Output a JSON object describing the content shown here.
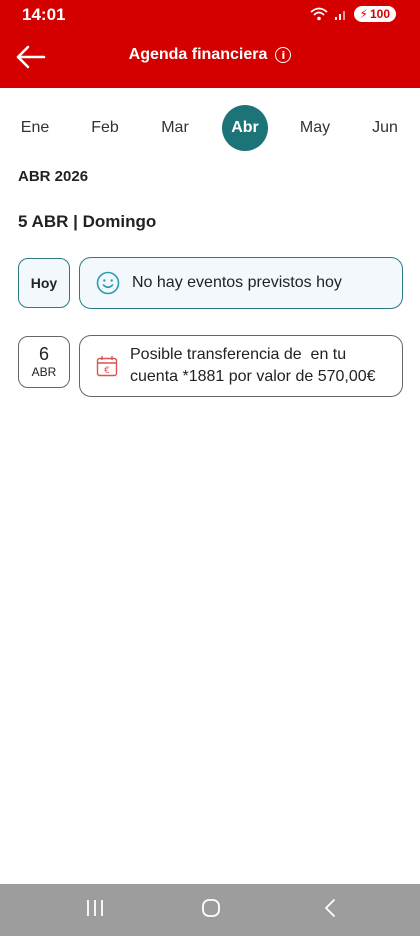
{
  "status_bar": {
    "time": "14:01",
    "battery": "100"
  },
  "header": {
    "title": "Agenda financiera",
    "info_glyph": "i"
  },
  "months": [
    "Ene",
    "Feb",
    "Mar",
    "Abr",
    "May",
    "Jun"
  ],
  "active_month": "Abr",
  "year_label": "ABR 2026",
  "day_heading": "5 ABR | Domingo",
  "today_box": {
    "label": "Hoy",
    "message": "No hay eventos previstos hoy"
  },
  "event": {
    "day": "6",
    "month": "ABR",
    "line1": "Posible transferencia de  en tu",
    "line2": "cuenta *1881 por valor de 570,00€"
  },
  "colors": {
    "header_red": "#d40000",
    "accent_teal": "#1c7479"
  }
}
